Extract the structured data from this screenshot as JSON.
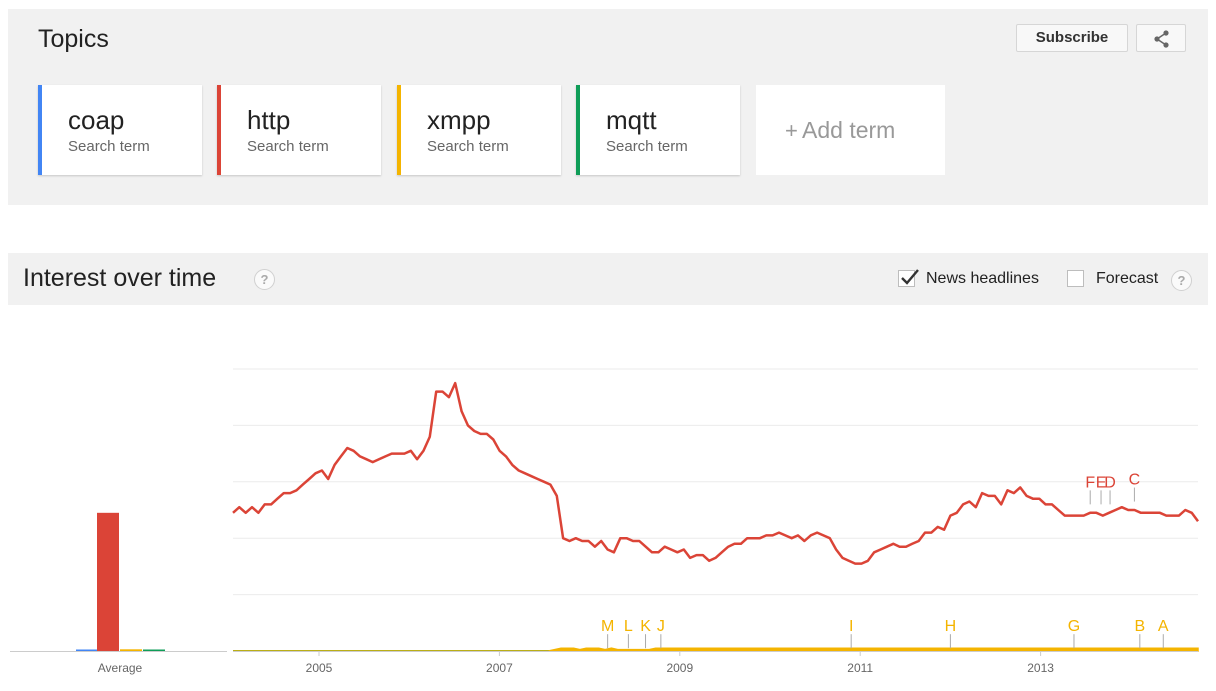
{
  "topics": {
    "title": "Topics",
    "subscribe_label": "Subscribe",
    "terms": [
      {
        "name": "coap",
        "type": "Search term",
        "color": "#4285f4"
      },
      {
        "name": "http",
        "type": "Search term",
        "color": "#db4437"
      },
      {
        "name": "xmpp",
        "type": "Search term",
        "color": "#f4b400"
      },
      {
        "name": "mqtt",
        "type": "Search term",
        "color": "#0f9d58"
      }
    ],
    "add_term_plus": "+",
    "add_term_label": "Add term"
  },
  "interest": {
    "title": "Interest over time",
    "help": "?",
    "news_label": "News headlines",
    "news_checked": true,
    "forecast_label": "Forecast",
    "forecast_checked": false
  },
  "chart_data": {
    "type": "line",
    "x_ticks": [
      "2005",
      "2007",
      "2009",
      "2011",
      "2013"
    ],
    "ylim": [
      0,
      100
    ],
    "grid": true,
    "average_label": "Average",
    "averages": [
      {
        "name": "coap",
        "value": 0.3
      },
      {
        "name": "http",
        "value": 49
      },
      {
        "name": "xmpp",
        "value": 0.6
      },
      {
        "name": "mqtt",
        "value": 0.3
      }
    ],
    "x_start": 2004.0,
    "x_step": 0.0833,
    "series": [
      {
        "name": "http",
        "color": "#db4437",
        "values": [
          49,
          51,
          49,
          51,
          49,
          52,
          52,
          54,
          56,
          56,
          57,
          59,
          61,
          63,
          64,
          61,
          66,
          69,
          72,
          71,
          69,
          68,
          67,
          68,
          69,
          70,
          70,
          70,
          71,
          68,
          71,
          76,
          92,
          92,
          90,
          95,
          85,
          80,
          78,
          77,
          77,
          75,
          71,
          69,
          66,
          64,
          63,
          62,
          61,
          60,
          59,
          55,
          40,
          39,
          40,
          39,
          39,
          37,
          39,
          36,
          35,
          40,
          40,
          39,
          39,
          37,
          35,
          35,
          37,
          36,
          35,
          36,
          33,
          34,
          34,
          32,
          33,
          35,
          37,
          38,
          38,
          40,
          40,
          40,
          41,
          41,
          42,
          41,
          40,
          41,
          39,
          41,
          42,
          41,
          40,
          36,
          33,
          32,
          31,
          31,
          32,
          35,
          36,
          37,
          38,
          37,
          37,
          38,
          39,
          42,
          42,
          44,
          43,
          48,
          49,
          52,
          53,
          51,
          56,
          55,
          55,
          52,
          57,
          56,
          58,
          55,
          54,
          54,
          52,
          52,
          50,
          48,
          48,
          48,
          48,
          49,
          49,
          48,
          49,
          50,
          51,
          50,
          50,
          49,
          49,
          49,
          49,
          48,
          48,
          48,
          50,
          49,
          46
        ]
      },
      {
        "name": "xmpp",
        "color": "#f4b400",
        "values": [
          0,
          0,
          0,
          0,
          0,
          0,
          0,
          0,
          0,
          0,
          0,
          0,
          0,
          0,
          0,
          0,
          0,
          0,
          0,
          0,
          0,
          0,
          0,
          0,
          0,
          0,
          0,
          0,
          0,
          0,
          0,
          0,
          0,
          0,
          0,
          0,
          0,
          0,
          0,
          0,
          0,
          0,
          0,
          0,
          0,
          0,
          0,
          0,
          0,
          0,
          0,
          0.5,
          1,
          1,
          1,
          0.5,
          1,
          1,
          1,
          0.5,
          1,
          0.5,
          0.5,
          0.5,
          0.5,
          0.5,
          0.5,
          1,
          1,
          1,
          1,
          1,
          1,
          1,
          1,
          1,
          1,
          1,
          1,
          1,
          1,
          1,
          1,
          1,
          1,
          1,
          1,
          1,
          1,
          1,
          1,
          1,
          1,
          1,
          1,
          1,
          1,
          1,
          1,
          1,
          1,
          1,
          1,
          1,
          1,
          1,
          1,
          1,
          1,
          1,
          1,
          1,
          1,
          1,
          1,
          1,
          1,
          1,
          1,
          1,
          1,
          1,
          1,
          1,
          1,
          1,
          1,
          1,
          1,
          1,
          1,
          1,
          1,
          1,
          1,
          1,
          1,
          1,
          1,
          1,
          1,
          1,
          1,
          1,
          1,
          1,
          1,
          1,
          1,
          1,
          1,
          1,
          1,
          1
        ]
      },
      {
        "name": "mqtt",
        "color": "#0f9d58",
        "values": [
          0,
          0,
          0,
          0,
          0,
          0,
          0,
          0,
          0,
          0,
          0,
          0,
          0,
          0,
          0,
          0,
          0,
          0,
          0,
          0,
          0,
          0,
          0,
          0,
          0,
          0,
          0,
          0,
          0,
          0,
          0,
          0,
          0,
          0,
          0,
          0,
          0,
          0,
          0,
          0,
          0,
          0,
          0,
          0,
          0,
          0,
          0,
          0,
          0,
          0,
          0,
          0,
          0,
          0,
          0,
          0,
          0,
          0,
          0,
          0,
          0,
          0,
          0,
          0,
          0,
          0,
          0,
          0,
          0,
          0,
          0,
          0,
          0,
          0,
          0,
          0,
          0,
          0,
          0,
          0,
          0,
          0,
          0,
          0,
          0,
          0,
          0,
          0,
          0,
          0,
          0,
          0,
          0,
          0,
          0,
          0,
          0,
          0,
          0,
          0,
          0,
          0,
          0,
          0,
          0,
          0,
          0,
          0,
          0,
          0,
          0,
          0,
          0,
          0,
          0,
          0,
          0,
          0,
          0,
          0,
          0,
          0,
          0,
          0,
          0,
          0,
          0,
          0,
          0,
          0,
          0,
          0,
          0,
          0,
          0,
          0,
          0,
          0,
          0,
          0,
          0,
          0,
          0,
          0,
          0,
          0,
          0,
          0,
          0,
          0,
          0,
          0,
          0.2
        ]
      },
      {
        "name": "coap",
        "color": "#4285f4",
        "values": [
          0,
          0,
          0,
          0,
          0,
          0,
          0,
          0,
          0,
          0,
          0,
          0,
          0,
          0,
          0,
          0,
          0,
          0,
          0,
          0,
          0,
          0,
          0,
          0,
          0,
          0,
          0,
          0,
          0,
          0,
          0,
          0,
          0,
          0,
          0,
          0,
          0,
          0,
          0,
          0,
          0,
          0,
          0,
          0,
          0,
          0,
          0,
          0,
          0,
          0,
          0,
          0,
          0,
          0,
          0,
          0,
          0,
          0,
          0,
          0,
          0,
          0,
          0,
          0,
          0,
          0,
          0,
          0,
          0,
          0,
          0,
          0,
          0,
          0,
          0,
          0,
          0,
          0,
          0,
          0,
          0,
          0,
          0,
          0,
          0,
          0,
          0,
          0,
          0,
          0,
          0,
          0,
          0,
          0,
          0,
          0,
          0,
          0,
          0,
          0,
          0,
          0,
          0,
          0,
          0,
          0,
          0,
          0,
          0,
          0,
          0,
          0,
          0,
          0,
          0,
          0,
          0,
          0,
          0,
          0,
          0,
          0,
          0,
          0,
          0,
          0,
          0,
          0,
          0,
          0,
          0,
          0,
          0,
          0,
          0,
          0,
          0,
          0,
          0,
          0,
          0,
          0,
          0,
          0,
          0,
          0,
          0,
          0,
          0,
          0,
          0,
          0,
          0
        ]
      }
    ],
    "annotations": [
      {
        "label": "F",
        "series": "http",
        "x": 2013.55,
        "value": 52
      },
      {
        "label": "E",
        "series": "http",
        "x": 2013.67,
        "value": 52
      },
      {
        "label": "D",
        "series": "http",
        "x": 2013.77,
        "value": 52
      },
      {
        "label": "C",
        "series": "http",
        "x": 2014.04,
        "value": 53
      },
      {
        "label": "M",
        "series": "xmpp",
        "x": 2008.2,
        "value": 1
      },
      {
        "label": "L",
        "series": "xmpp",
        "x": 2008.43,
        "value": 1
      },
      {
        "label": "K",
        "series": "xmpp",
        "x": 2008.62,
        "value": 1
      },
      {
        "label": "J",
        "series": "xmpp",
        "x": 2008.79,
        "value": 1
      },
      {
        "label": "I",
        "series": "xmpp",
        "x": 2010.9,
        "value": 1
      },
      {
        "label": "H",
        "series": "xmpp",
        "x": 2012.0,
        "value": 1
      },
      {
        "label": "G",
        "series": "xmpp",
        "x": 2013.37,
        "value": 1
      },
      {
        "label": "B",
        "series": "xmpp",
        "x": 2014.1,
        "value": 1
      },
      {
        "label": "A",
        "series": "xmpp",
        "x": 2014.36,
        "value": 1
      }
    ]
  }
}
